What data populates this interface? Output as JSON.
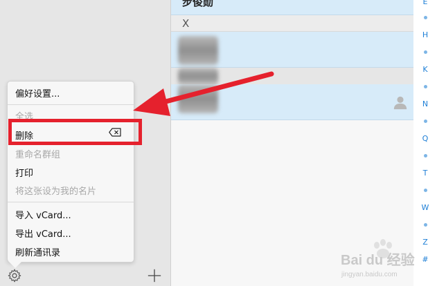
{
  "contacts": {
    "top_row_name": "步俊勋",
    "section_letter": "X"
  },
  "index_bar": {
    "letters": [
      "E",
      "H",
      "K",
      "N",
      "Q",
      "T",
      "W",
      "Z",
      "#"
    ]
  },
  "menu": {
    "preferences": "偏好设置...",
    "select_all": "全选",
    "delete": "删除",
    "rename_group": "重命名群组",
    "print": "打印",
    "set_my_card": "将这张设为我的名片",
    "import_vcard": "导入 vCard...",
    "export_vcard": "导出 vCard...",
    "refresh": "刷新通讯录"
  },
  "watermark": {
    "logo_text": "Bai du 经验",
    "url": "jingyan.baidu.com"
  },
  "colors": {
    "highlight": "#e5212d",
    "selected_row": "#d7ebf9",
    "index_link": "#1e7fd6"
  }
}
